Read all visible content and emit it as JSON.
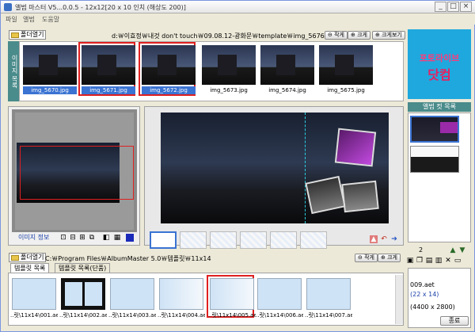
{
  "window": {
    "title": "앨범 마스터 V5...0.0.5 - 12x12[20 x 10 인치 (해상도 200)]",
    "minimize": "_",
    "maximize": "□",
    "close": "×"
  },
  "menu": [
    "파일",
    "앨범",
    "도움말"
  ],
  "top_strip": {
    "folder_button": "폴더열기",
    "path": "d:￦이효정￦내것 don't touch￦09.08.12-광화문￦template￦img_5676.jpg",
    "smaller_button": "작게",
    "larger_button": "크게",
    "large_view_button": "크게보기",
    "side_tab": "이미지 목록",
    "thumbnails": [
      {
        "name": "img_5670.jpg",
        "selected": true,
        "red": false
      },
      {
        "name": "img_5671.jpg",
        "selected": true,
        "red": true
      },
      {
        "name": "img_5672.jpg",
        "selected": true,
        "red": true
      },
      {
        "name": "img_5673.jpg",
        "selected": false,
        "red": false
      },
      {
        "name": "img_5674.jpg",
        "selected": false,
        "red": false
      },
      {
        "name": "img_5675.jpg",
        "selected": false,
        "red": false
      }
    ]
  },
  "preview": {
    "image_info_label": "이미지 정보"
  },
  "ad": {
    "line1": "포토라이브",
    "line2": "닷컴"
  },
  "album_cut_list": {
    "header": "앨범 컷 목록",
    "page_number": "2"
  },
  "template_section": {
    "folder_button": "폴더열기",
    "path": "C:￦Program Files￦AlbumMaster 5.0￦템플릿￦11x14",
    "smaller_button": "작게",
    "larger_button": "크게",
    "tabs": [
      "템플릿 목록",
      "템플릿 목록(단품)"
    ],
    "items": [
      {
        "label": "..릿\\11x14\\001.aet",
        "red": false
      },
      {
        "label": "..릿\\11x14\\002.aet",
        "red": false
      },
      {
        "label": "..릿\\11x14\\003.aet",
        "red": false
      },
      {
        "label": "..릿\\11x14\\004.aet",
        "red": false
      },
      {
        "label": "..릿\\11x14\\005.aet",
        "red": true
      },
      {
        "label": "..릿\\11x14\\006.aet",
        "red": false
      },
      {
        "label": "..릿\\11x14\\007.aet",
        "red": false
      }
    ]
  },
  "info": {
    "filename": "009.aet",
    "size": "(22 x 14)",
    "pixels": "(4400 x 2800)",
    "close_button": "종료"
  },
  "colors": {
    "accent": "#3a73d2",
    "highlight_red": "#e02020",
    "side_tab": "#4a8b8b",
    "ad_bg": "#1fa8de"
  }
}
